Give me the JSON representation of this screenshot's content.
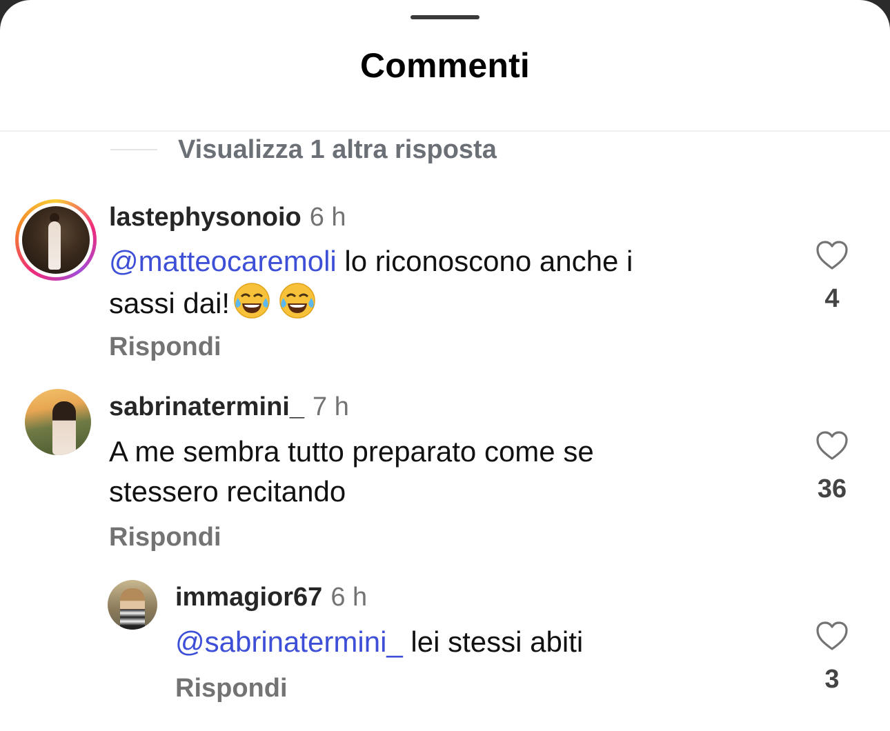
{
  "sheet": {
    "title": "Commenti"
  },
  "view_replies": {
    "label": "Visualizza 1 altra risposta"
  },
  "comments": [
    {
      "username": "lastephysonoio",
      "time": "6 h",
      "mention": "@matteocaremoli",
      "line1_rest": " lo riconoscono anche i",
      "line2": "sassi dai!",
      "emoji": [
        "face-with-tears-of-joy",
        "face-with-tears-of-joy"
      ],
      "reply_label": "Rispondi",
      "likes": "4",
      "has_story_ring": true
    },
    {
      "username": "sabrinatermini_",
      "time": "7 h",
      "line1": "A me sembra tutto preparato come se",
      "line2": "stessero recitando",
      "reply_label": "Rispondi",
      "likes": "36"
    },
    {
      "username": "immagior67",
      "time": "6 h",
      "mention": "@sabrinatermini_",
      "line1_rest": " lei stessi abiti",
      "reply_label": "Rispondi",
      "likes": "3",
      "is_reply": true
    }
  ],
  "icons": {
    "like": "heart-outline-icon"
  },
  "colors": {
    "mention": "#3d4fd6",
    "secondary_text": "#737373"
  }
}
